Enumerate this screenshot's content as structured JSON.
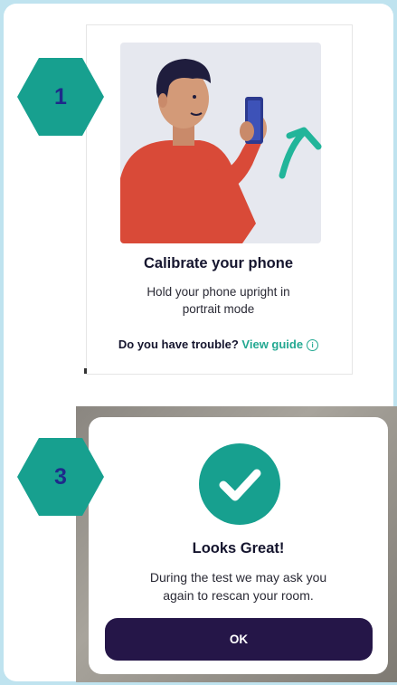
{
  "step1": {
    "badge": "1",
    "title": "Calibrate your phone",
    "subtitle_lines": [
      "Hold your phone upright in",
      "portrait mode"
    ],
    "trouble_text": "Do you have trouble?",
    "guide_link": "View guide",
    "info_glyph": "i"
  },
  "step3": {
    "badge": "3",
    "title": "Looks Great!",
    "body_lines": [
      "During the test we may ask you",
      "again to rescan your room."
    ],
    "ok_label": "OK"
  },
  "icons": {
    "illustration": "person-holding-phone-illustration",
    "arrow": "up-arrow-icon",
    "info": "info-icon",
    "check": "checkmark-icon"
  },
  "colors": {
    "background": "#bfe3ef",
    "teal": "#17a08f",
    "badge_text": "#1e2a8a",
    "button": "#251648",
    "link": "#22a891"
  }
}
